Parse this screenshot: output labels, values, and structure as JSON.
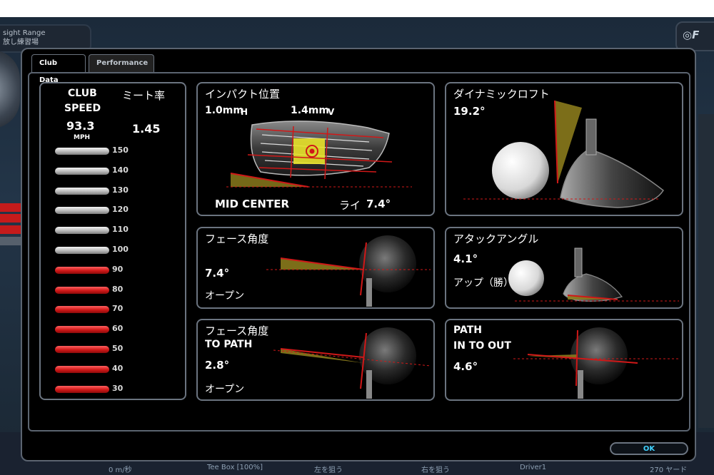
{
  "background": {
    "range_label_en": "sight Range",
    "range_label_jp": "放し練習場",
    "bottom_cells": [
      "0 m/秒",
      "Tee Box [100%]",
      "左を狙う",
      "右を狙う",
      "Driver1",
      "270 ヤード"
    ]
  },
  "tabs": [
    {
      "label": "Club Data",
      "active": true
    },
    {
      "label": "Performance",
      "active": false
    }
  ],
  "club_speed": {
    "label_line1": "CLUB",
    "label_line2": "SPEED",
    "value": "93.3",
    "unit": "MPH",
    "scale": [
      "150",
      "140",
      "130",
      "120",
      "110",
      "100",
      "90",
      "80",
      "70",
      "60",
      "50",
      "40",
      "30"
    ]
  },
  "smash": {
    "label": "ミート率",
    "value": "1.45"
  },
  "impact": {
    "title": "インパクト位置",
    "h_value": "1.0mm",
    "h_unit": "H",
    "v_value": "1.4mm",
    "v_unit": "V",
    "location": "MID CENTER",
    "lie_label": "ライ",
    "lie_value": "7.4°"
  },
  "dynamic_loft": {
    "title": "ダイナミックロフト",
    "value": "19.2°"
  },
  "face_angle": {
    "title": "フェース角度",
    "value": "7.4°",
    "state": "オープン"
  },
  "attack_angle": {
    "title": "アタックアングル",
    "value": "4.1°",
    "state": "アップ（勝）"
  },
  "face_to_path": {
    "title": "フェース角度",
    "subtitle": "TO PATH",
    "value": "2.8°",
    "state": "オープン"
  },
  "path": {
    "title": "PATH",
    "subtitle": "IN TO OUT",
    "value": "4.6°"
  },
  "ok_button": "OK",
  "colors": {
    "accent_red": "#d01818",
    "wedge_fill": "#8a7a1c",
    "ok_text": "#3fd1ff"
  }
}
